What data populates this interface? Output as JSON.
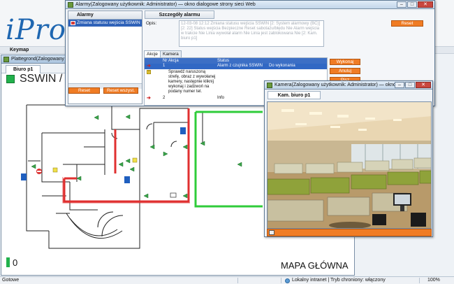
{
  "app": {
    "brand": "iProt",
    "menu": {
      "keymap": "Keymap"
    }
  },
  "plan_window": {
    "title": "Plattegrond(Zalogowany uży",
    "tab": "Biuro p1",
    "name": "SSWIN / C",
    "count": "0",
    "caption": "MAPA GŁÓWNA"
  },
  "alarm_window": {
    "title": "Alarmy(Zalogowany użytkownik: Administrator) — okno dialogowe strony sieci Web",
    "list_header": "Alarmy",
    "alarm_item": "Zmiana statusu wejścia SSWIN",
    "details_tab": "Szczegóły alarmu",
    "opis_label": "Opis:",
    "opis_text": "12-03-08 12:12 Zmiana statusu wejścia SSWIN [2: System alarmowy (BC)] [2: 22] Status wejścia Bezpieczne Reset sabotażu/błędu Nie Alarm wejścia w trakcie Nie Linia wywołał alarm Nie Linia jest zablokowana Nie [2: Kam. biuro p1]",
    "tab_akcje": "Akcje",
    "tab_kamera": "Kamera",
    "columns": {
      "nr": "Nr",
      "akcja": "Akcja",
      "status": "Status"
    },
    "rows": [
      {
        "nr": "1",
        "akcja": "",
        "status": "Alarm z czujnika SSWIN",
        "status2": "Do wykonania"
      },
      {
        "nr": "",
        "akcja": "Sprawdź naruszoną strefę, obraz z wywołanej kamery, następnie kliknij wykonaj i zadzwoń na podany numer tel.",
        "status": "",
        "status2": ""
      },
      {
        "nr": "2",
        "akcja": "",
        "status": "Info",
        "status2": ""
      }
    ],
    "buttons": {
      "reset_left": "Reset",
      "reset_all": "Reset wszyst.",
      "reset_top": "Reset",
      "wykonaj": "Wykonaj",
      "anuluj": "Anuluj",
      "pisz": "Pisz"
    }
  },
  "camera_window": {
    "title": "Kamera(Zalogowany użytkownik: Administrator) — okno dialo...",
    "tab": "Kam. biuro p1"
  },
  "window_controls": {
    "minimize": "–",
    "maximize": "□",
    "close": "✕"
  },
  "statusbar": {
    "left": "Gotowe",
    "zone": "Lokalny intranet | Tryb chroniony: włączony",
    "zoom": "100%"
  },
  "colors": {
    "accent_orange": "#f07c24",
    "selection_blue": "#3168c4",
    "alarm_red": "#e03030",
    "ok_green": "#22b14c",
    "brand_blue": "#1f67b1"
  },
  "icons": [
    "window-icon",
    "alarm-arrow-icon",
    "info-icon",
    "globe-icon",
    "exit-sign-icon",
    "no-entry-icon",
    "camera-icon",
    "snapshot-icon"
  ]
}
